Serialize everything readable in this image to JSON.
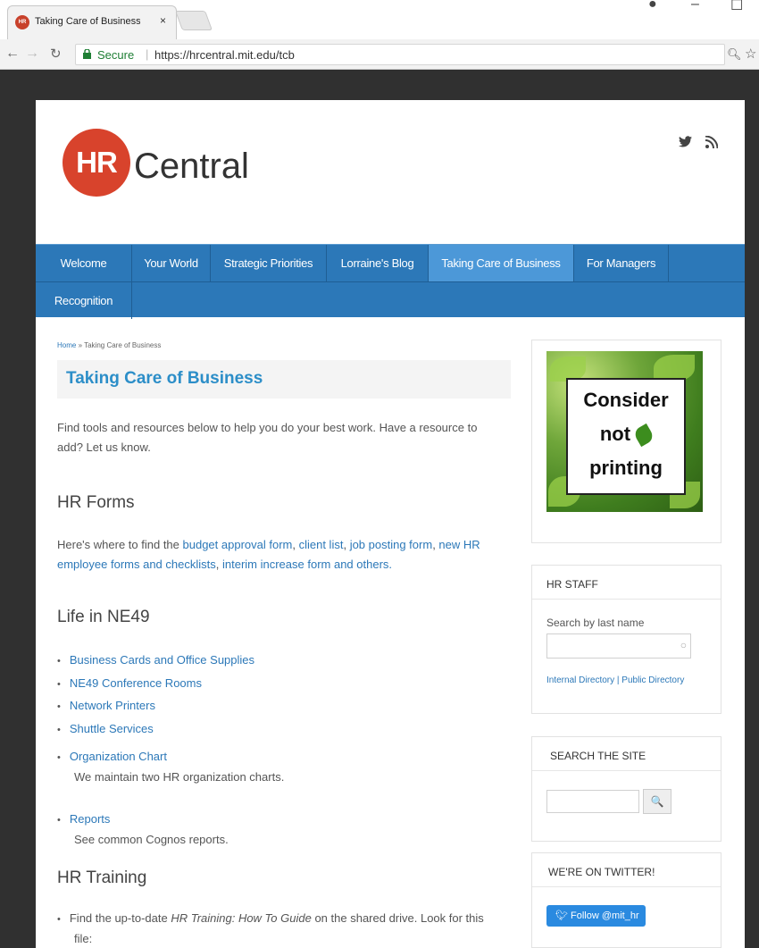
{
  "browser": {
    "tab_title": "Taking Care of Business |",
    "tab_close": "×",
    "favicon_text": "HR",
    "secure_label": "Secure",
    "url": "https://hrcentral.mit.edu/tcb"
  },
  "header": {
    "logo_mark": "HR",
    "logo_text": "Central",
    "social_twitter": "🐦",
    "social_rss": "⌇"
  },
  "nav": {
    "items": [
      {
        "label": "Welcome"
      },
      {
        "label": "Your World"
      },
      {
        "label": "Strategic Priorities"
      },
      {
        "label": "Lorraine's Blog"
      },
      {
        "label": "Taking Care of Business",
        "active": true
      },
      {
        "label": "For Managers"
      },
      {
        "label": "Recognition"
      }
    ]
  },
  "main": {
    "breadcrumb": {
      "home": "Home",
      "sep": " » ",
      "current": "Taking Care of Business"
    },
    "title": "Taking Care of Business",
    "intro": "Find tools and resources below to help you do your best work. Have a resource to add? Let us know.",
    "forms": {
      "heading": "HR Forms",
      "prefix": "Here's where to find the ",
      "links": [
        "budget approval form",
        "client list",
        "job posting form",
        "new HR employee forms and checklists",
        "interim increase form and others."
      ]
    },
    "life": {
      "heading": "Life in NE49",
      "items": [
        "Business Cards and Office Supplies",
        "NE49 Conference Rooms",
        "Network Printers",
        "Shuttle Services"
      ],
      "org_chart": {
        "label": "Organization Chart",
        "desc": "We maintain two HR organization charts."
      },
      "reports": {
        "label": "Reports",
        "desc": "See common Cognos reports."
      }
    },
    "training": {
      "heading": "HR Training",
      "item_prefix": "Find the up-to-date ",
      "item_em": "HR Training: How To Guide",
      "item_suffix": " on the shared drive. Look for this",
      "item_line2": "file:"
    }
  },
  "sidebar": {
    "poster": {
      "line1": "Consider",
      "line2": "not",
      "line3": "printing"
    },
    "hr_staff": {
      "title": "HR STAFF",
      "search_label": "Search by last name",
      "internal": "Internal Directory",
      "divider": " | ",
      "public": "Public Directory"
    },
    "search_site": {
      "title": "SEARCH THE SITE",
      "button": "🔍"
    },
    "twitter": {
      "title": "WE'RE ON TWITTER!",
      "button": "Follow @mit_hr"
    }
  }
}
